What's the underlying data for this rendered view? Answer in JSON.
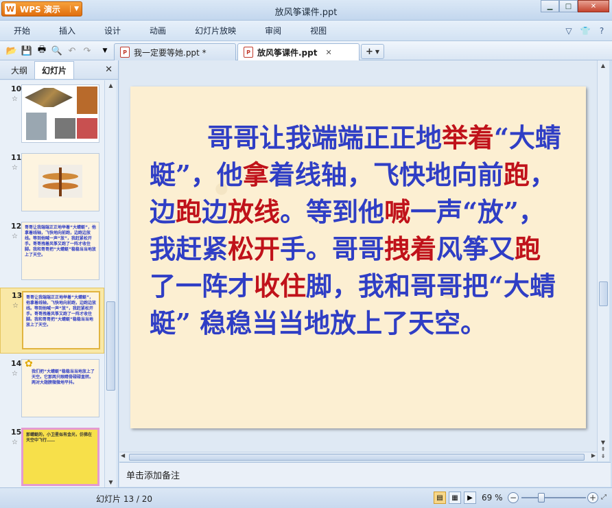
{
  "app": {
    "brand": "WPS 演示",
    "window_title": "放风筝课件.ppt"
  },
  "menu": [
    "开始",
    "插入",
    "设计",
    "动画",
    "幻灯片放映",
    "审阅",
    "视图"
  ],
  "doc_tabs": [
    {
      "label": "我一定要等她.ppt *",
      "active": false
    },
    {
      "label": "放风筝课件.ppt",
      "active": true
    }
  ],
  "left_panel": {
    "tabs": [
      "大纲",
      "幻灯片"
    ],
    "active_tab": "幻灯片",
    "slides": [
      {
        "num": "10",
        "content": "images"
      },
      {
        "num": "11",
        "content": "image"
      },
      {
        "num": "12",
        "text": "哥哥让我端端正正地举着“大蜻蜓”，他拿着线轴，飞快地向前跑，边跑边放线。等到他喊一声“放”，我赶紧松开手。哥哥拽着风筝又跑了一阵才收住脚。我和哥哥把“大蜻蜓”稳稳当当地放上了天空。"
      },
      {
        "num": "13",
        "text": "哥哥让我端端正正地举着“大蜻蜓”，他拿着线轴，飞快地向前跑，边跑边放线。等到他喊一声“放”，我赶紧松开手。哥哥拽着风筝又跑了一阵才收住脚。我和哥哥把“大蜻蜓”稳稳当当地放上了天空。",
        "selected": true
      },
      {
        "num": "14",
        "text": "我们把“大蜻蜓”稳稳当当地放上了天空。它那两只眼睛骨碌碌直转。两对大翅膀微微地平抖。"
      },
      {
        "num": "15",
        "text": "那蜻蜓的，小卫星似有金光，仿佛在天空中飞行……"
      }
    ]
  },
  "slide": {
    "segments": [
      {
        "t": "哥哥让我端端正正地",
        "c": "b"
      },
      {
        "t": "举着",
        "c": "r"
      },
      {
        "t": "“大蜻蜓”，他",
        "c": "b"
      },
      {
        "t": "拿",
        "c": "r"
      },
      {
        "t": "着线轴，飞快地向前",
        "c": "b"
      },
      {
        "t": "跑",
        "c": "r"
      },
      {
        "t": "，边",
        "c": "b"
      },
      {
        "t": "跑",
        "c": "r"
      },
      {
        "t": "边",
        "c": "b"
      },
      {
        "t": "放线",
        "c": "r"
      },
      {
        "t": "。等到他",
        "c": "b"
      },
      {
        "t": "喊",
        "c": "r"
      },
      {
        "t": "一声“放”，我赶紧",
        "c": "b"
      },
      {
        "t": "松开",
        "c": "r"
      },
      {
        "t": "手。哥哥",
        "c": "b"
      },
      {
        "t": "拽着",
        "c": "r"
      },
      {
        "t": "风筝又",
        "c": "b"
      },
      {
        "t": "跑",
        "c": "r"
      },
      {
        "t": "了一阵才",
        "c": "b"
      },
      {
        "t": "收住",
        "c": "r"
      },
      {
        "t": "脚，我和哥哥把“大蜻蜓” 稳稳当当地放上了天空。",
        "c": "b"
      }
    ]
  },
  "notes_placeholder": "单击添加备注",
  "status": {
    "slide_indicator": "幻灯片 13 / 20",
    "zoom": "69 %"
  },
  "colors": {
    "slide_blue": "#2f3ec5",
    "slide_red": "#c0121a",
    "slide_bg": "#fcefd2"
  }
}
